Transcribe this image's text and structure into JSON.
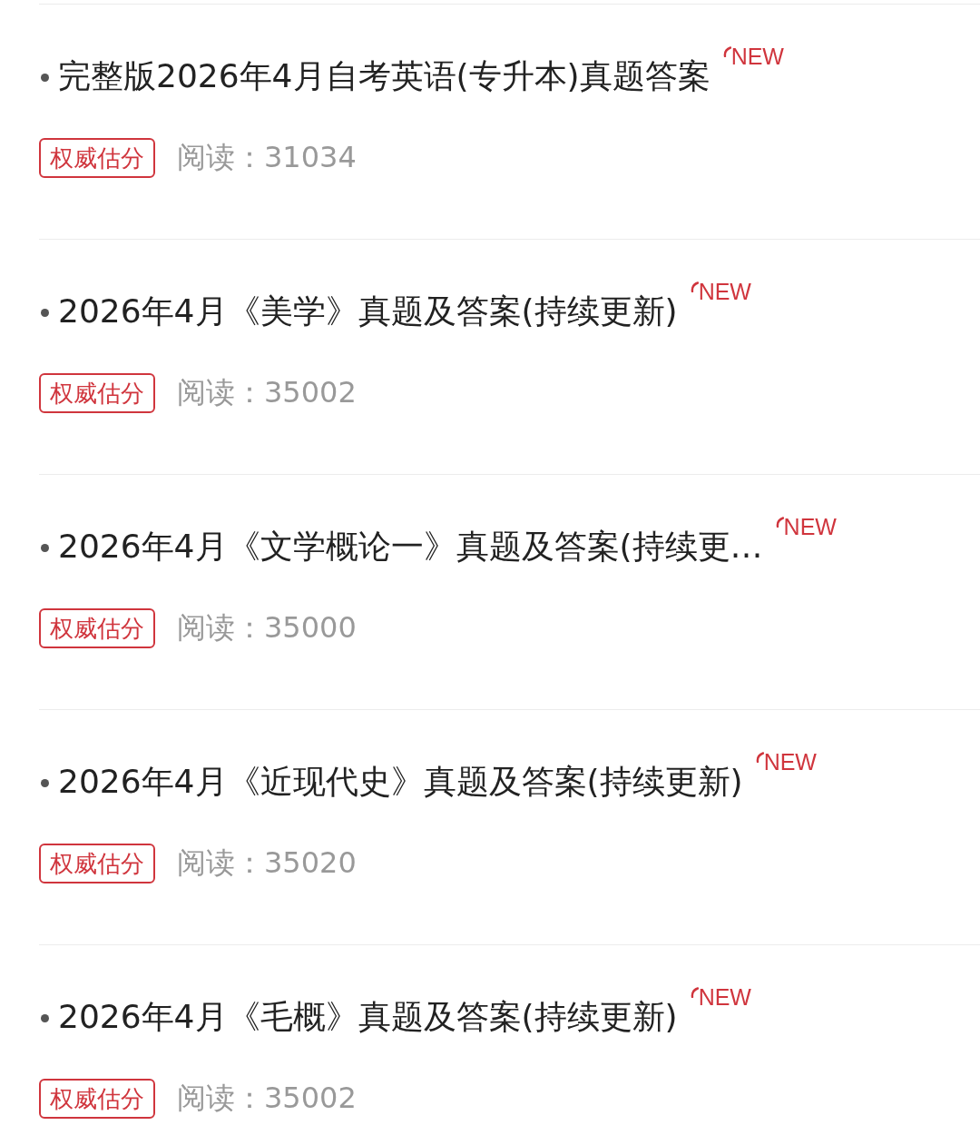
{
  "articles": [
    {
      "title": "完整版2026年4月自考英语(专升本)真题答案",
      "badge": "NEW",
      "tag": "权威估分",
      "reads": "阅读：31034"
    },
    {
      "title": "2026年4月《美学》真题及答案(持续更新)",
      "badge": "NEW",
      "tag": "权威估分",
      "reads": "阅读：35002"
    },
    {
      "title": "2026年4月《文学概论一》真题及答案(持续更…",
      "badge": "NEW",
      "tag": "权威估分",
      "reads": "阅读：35000"
    },
    {
      "title": "2026年4月《近现代史》真题及答案(持续更新)",
      "badge": "NEW",
      "tag": "权威估分",
      "reads": "阅读：35020"
    },
    {
      "title": "2026年4月《毛概》真题及答案(持续更新)",
      "badge": "NEW",
      "tag": "权威估分",
      "reads": "阅读：35002"
    }
  ]
}
